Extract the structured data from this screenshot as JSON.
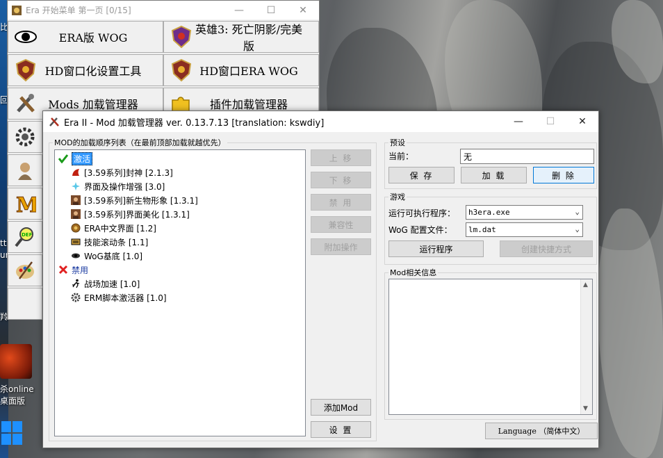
{
  "desktop": {
    "left_labels": [
      "比",
      "回",
      "ttr",
      "ur",
      "羚"
    ],
    "shortcut_label_1": "杀online",
    "shortcut_label_2": "桌面版"
  },
  "start_menu": {
    "title": "Era 开始菜单 第一页  [0/15]",
    "buttons": [
      {
        "label": "ERA版 WOG",
        "icon": "eye-icon"
      },
      {
        "label": "英雄3: 死亡阴影/完美版",
        "icon": "shield-icon"
      },
      {
        "label": "HD窗口化设置工具",
        "icon": "shield-icon"
      },
      {
        "label": "HD窗口ERA WOG",
        "icon": "shield-icon"
      },
      {
        "label": "Mods 加载管理器",
        "icon": "tools-icon"
      },
      {
        "label": "插件加载管理器",
        "icon": "puzzle-icon"
      }
    ]
  },
  "dialog": {
    "title": "Era II - Mod 加载管理器 ver. 0.13.7.13 [translation: kswdiy]",
    "mod_list_label": "MOD的加载顺序列表（在最前顶部加载就越优先）",
    "tree": {
      "enabled_group": "激活",
      "enabled_items": [
        {
          "label": "[3.59系列]封神 [2.1.3]",
          "icon": "dragon-icon"
        },
        {
          "label": "界面及操作增强 [3.0]",
          "icon": "sparkle-icon"
        },
        {
          "label": "[3.59系列]新生物形象 [1.3.1]",
          "icon": "portrait-icon"
        },
        {
          "label": "[3.59系列]界面美化 [1.3.1]",
          "icon": "portrait-icon"
        },
        {
          "label": "ERA中文界面 [1.2]",
          "icon": "gear-icon"
        },
        {
          "label": "技能滚动条 [1.1]",
          "icon": "scroll-icon"
        },
        {
          "label": "WoG基底 [1.0]",
          "icon": "eye-icon"
        }
      ],
      "disabled_group": "禁用",
      "disabled_items": [
        {
          "label": "战场加速 [1.0]",
          "icon": "runner-icon"
        },
        {
          "label": "ERM脚本激活器 [1.0]",
          "icon": "cog-icon"
        }
      ]
    },
    "side_buttons": {
      "move_up": "上 移",
      "move_down": "下 移",
      "disable": "禁 用",
      "compat": "兼容性",
      "extra": "附加操作",
      "add_mod": "添加Mod",
      "settings": "设 置"
    },
    "preset": {
      "label": "预设",
      "current_label": "当前：",
      "current_value": "无",
      "save": "保 存",
      "load": "加 载",
      "delete": "删 除"
    },
    "game": {
      "label": "游戏",
      "exe_label": "运行可执行程序：",
      "exe_value": "h3era.exe",
      "config_label": "WoG 配置文件：",
      "config_value": "lm.dat",
      "run": "运行程序",
      "shortcut": "创建快捷方式"
    },
    "info_label": "Mod相关信息",
    "language": "Language （简体中文）"
  }
}
